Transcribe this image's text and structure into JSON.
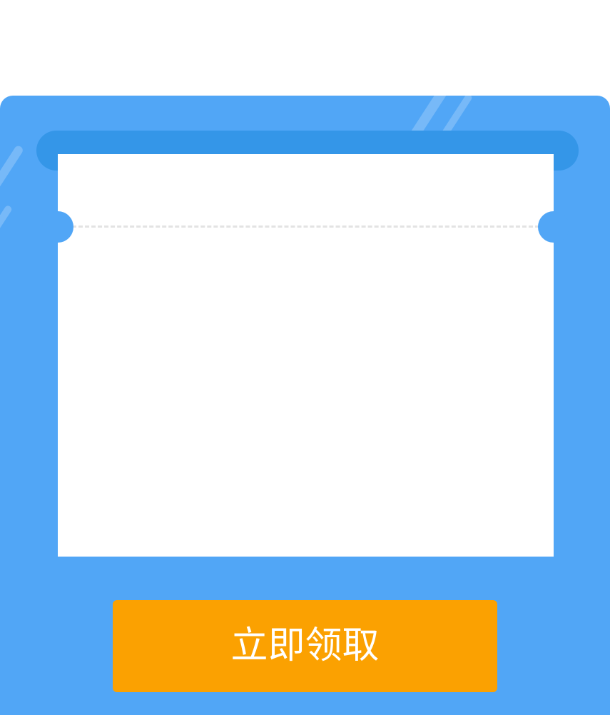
{
  "coupon": {
    "claim_button_label": "立即领取"
  },
  "colors": {
    "background": "#ffffff",
    "panel": "#51a6f6",
    "slot": "#3496e8",
    "ticket": "#ffffff",
    "perforation": "#e3e3e3",
    "button": "#fba101",
    "button_text": "#ffffff"
  }
}
